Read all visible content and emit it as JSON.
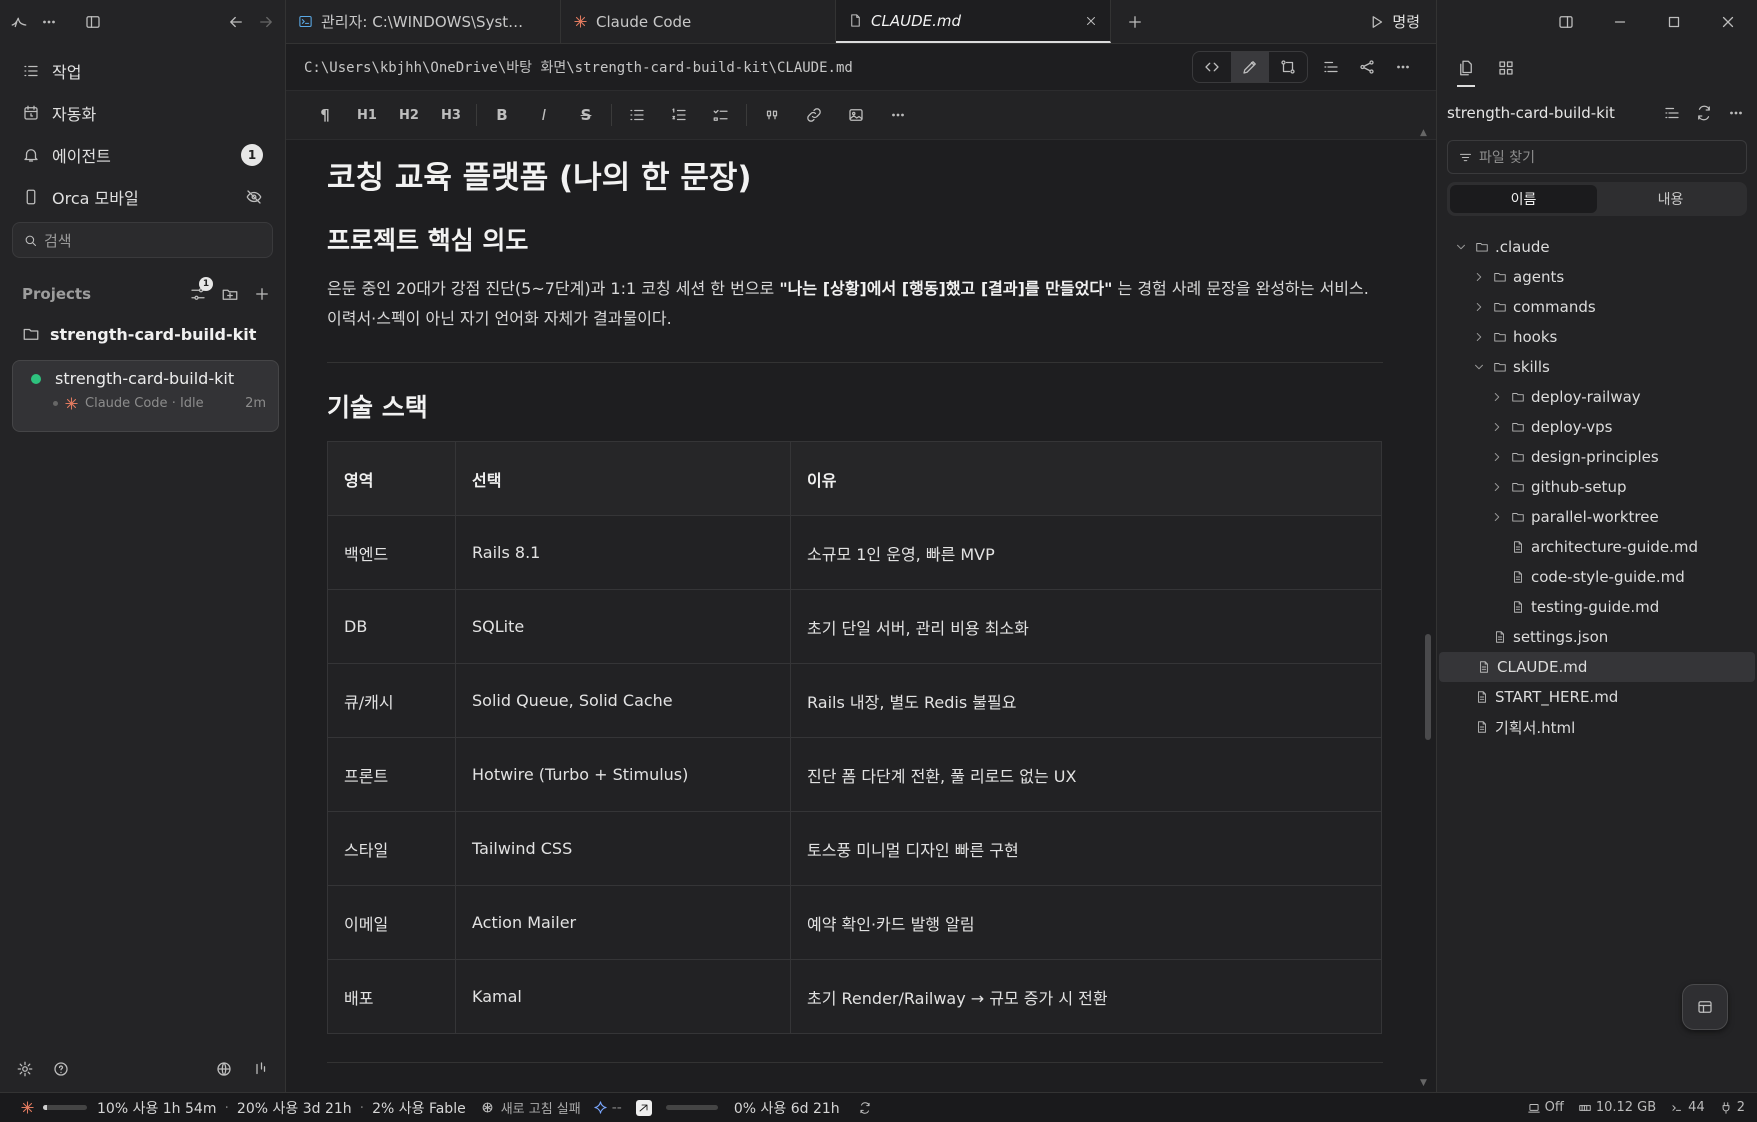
{
  "sidebar": {
    "nav": [
      {
        "label": "작업",
        "icon": "tasks-icon"
      },
      {
        "label": "자동화",
        "icon": "automation-icon"
      },
      {
        "label": "에이전트",
        "icon": "bell-icon",
        "badge": "1"
      },
      {
        "label": "Orca 모바일",
        "icon": "mobile-icon"
      }
    ],
    "search_placeholder": "검색",
    "projects_label": "Projects",
    "projects_filter_badge": "1",
    "project_folder": "strength-card-build-kit",
    "worktree": {
      "name": "strength-card-build-kit",
      "session": "Claude Code · Idle",
      "time": "2m"
    }
  },
  "tabs": [
    {
      "label": "관리자: C:\\WINDOWS\\Syst…",
      "icon": "terminal-icon"
    },
    {
      "label": "Claude Code",
      "icon": "claude-icon"
    },
    {
      "label": "CLAUDE.md",
      "icon": "file-icon",
      "active": true
    }
  ],
  "run_label": "명령",
  "file_path": "C:\\Users\\kbjhh\\OneDrive\\바탕 화면\\strength-card-build-kit\\CLAUDE.md",
  "toolbar": [
    "¶",
    "H1",
    "H2",
    "H3",
    "B",
    "I",
    "S"
  ],
  "doc": {
    "title": "코칭 교육 플랫폼 (나의 한 문장)",
    "section1": "프로젝트 핵심 의도",
    "para_pre": "은둔 중인 20대가 강점 진단(5~7단계)과 1:1 코칭 세션 한 번으로 ",
    "para_bold": "\"나는 [상황]에서 [행동]했고 [결과]를 만들었다\"",
    "para_post": " 는 경험 사례 문장을 완성하는 서비스. 이력서·스펙이 아닌 자기 언어화 자체가 결과물이다.",
    "section2": "기술 스택",
    "table": {
      "headers": [
        "영역",
        "선택",
        "이유"
      ],
      "rows": [
        [
          "백엔드",
          "Rails 8.1",
          "소규모 1인 운영, 빠른 MVP"
        ],
        [
          "DB",
          "SQLite",
          "초기 단일 서버, 관리 비용 최소화"
        ],
        [
          "큐/캐시",
          "Solid Queue, Solid Cache",
          "Rails 내장, 별도 Redis 불필요"
        ],
        [
          "프론트",
          "Hotwire (Turbo + Stimulus)",
          "진단 폼 다단계 전환, 풀 리로드 없는 UX"
        ],
        [
          "스타일",
          "Tailwind CSS",
          "토스풍 미니멀 디자인 빠른 구현"
        ],
        [
          "이메일",
          "Action Mailer",
          "예약 확인·카드 발행 알림"
        ],
        [
          "배포",
          "Kamal",
          "초기 Render/Railway → 규모 증가 시 전환"
        ]
      ]
    }
  },
  "explorer": {
    "root": "strength-card-build-kit",
    "search_placeholder": "파일 찾기",
    "seg_name": "이름",
    "seg_content": "내용",
    "tree": [
      {
        "name": ".claude",
        "type": "folder",
        "depth": 0,
        "open": true
      },
      {
        "name": "agents",
        "type": "folder",
        "depth": 1
      },
      {
        "name": "commands",
        "type": "folder",
        "depth": 1
      },
      {
        "name": "hooks",
        "type": "folder",
        "depth": 1
      },
      {
        "name": "skills",
        "type": "folder",
        "depth": 1,
        "open": true
      },
      {
        "name": "deploy-railway",
        "type": "folder",
        "depth": 2
      },
      {
        "name": "deploy-vps",
        "type": "folder",
        "depth": 2
      },
      {
        "name": "design-principles",
        "type": "folder",
        "depth": 2
      },
      {
        "name": "github-setup",
        "type": "folder",
        "depth": 2
      },
      {
        "name": "parallel-worktree",
        "type": "folder",
        "depth": 2
      },
      {
        "name": "architecture-guide.md",
        "type": "file",
        "depth": 2
      },
      {
        "name": "code-style-guide.md",
        "type": "file",
        "depth": 2
      },
      {
        "name": "testing-guide.md",
        "type": "file",
        "depth": 2
      },
      {
        "name": "settings.json",
        "type": "file",
        "depth": 1
      },
      {
        "name": "CLAUDE.md",
        "type": "file",
        "depth": 0,
        "selected": true
      },
      {
        "name": "START_HERE.md",
        "type": "file",
        "depth": 0
      },
      {
        "name": "기획서.html",
        "type": "file",
        "depth": 0
      }
    ]
  },
  "status": {
    "usage1": {
      "text": "10% 사용 1h 54m",
      "fraction": 0.1
    },
    "usage2": "20% 사용 3d 21h",
    "usage3": "2% 사용 Fable",
    "refresh": "새로 고침 실패",
    "gem": "--",
    "usage4": {
      "text": "0% 사용 6d 21h",
      "fraction": 0.0
    },
    "off": "Off",
    "mem": "10.12 GB",
    "term": "44",
    "ports": "2"
  }
}
